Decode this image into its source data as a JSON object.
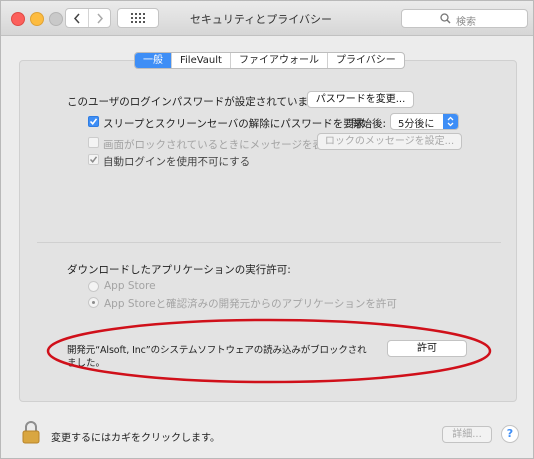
{
  "window": {
    "title": "セキュリティとプライバシー"
  },
  "toolbar": {
    "back_icon": "chevron-left-icon",
    "forward_icon": "chevron-right-icon",
    "grid_icon": "grid-icon",
    "search_placeholder": "検索"
  },
  "tabs": [
    {
      "label": "一般",
      "active": true
    },
    {
      "label": "FileVault",
      "active": false
    },
    {
      "label": "ファイアウォール",
      "active": false
    },
    {
      "label": "プライバシー",
      "active": false
    }
  ],
  "general": {
    "password_set_text": "このユーザのログインパスワードが設定されています",
    "change_password_button": "パスワードを変更...",
    "require_password_label": "スリープとスクリーンセーバの解除にパスワードを要求",
    "require_password_checked": true,
    "start_after_label": "開始後:",
    "start_after_value": "5分後に",
    "lock_message_label": "画面がロックされているときにメッセージを表示",
    "lock_message_checked": false,
    "lock_message_button": "ロックのメッセージを設定...",
    "auto_login_label": "自動ログインを使用不可にする",
    "auto_login_checked": true
  },
  "downloads": {
    "heading": "ダウンロードしたアプリケーションの実行許可:",
    "option_app_store": "App Store",
    "option_app_store_identified": "App Storeと確認済みの開発元からのアプリケーションを許可",
    "selected": "option_app_store_identified",
    "blocked_text_line1": "開発元“Alsoft, Inc”のシステムソフトウェアの読み込みがブロックされ",
    "blocked_text_line2": "ました。",
    "allow_button": "許可"
  },
  "footer": {
    "lock_text": "変更するにはカギをクリックします。",
    "advanced_button": "詳細...",
    "help_button": "?"
  },
  "colors": {
    "accent": "#3e8ef6",
    "annotation_ellipse": "#d0101a"
  }
}
